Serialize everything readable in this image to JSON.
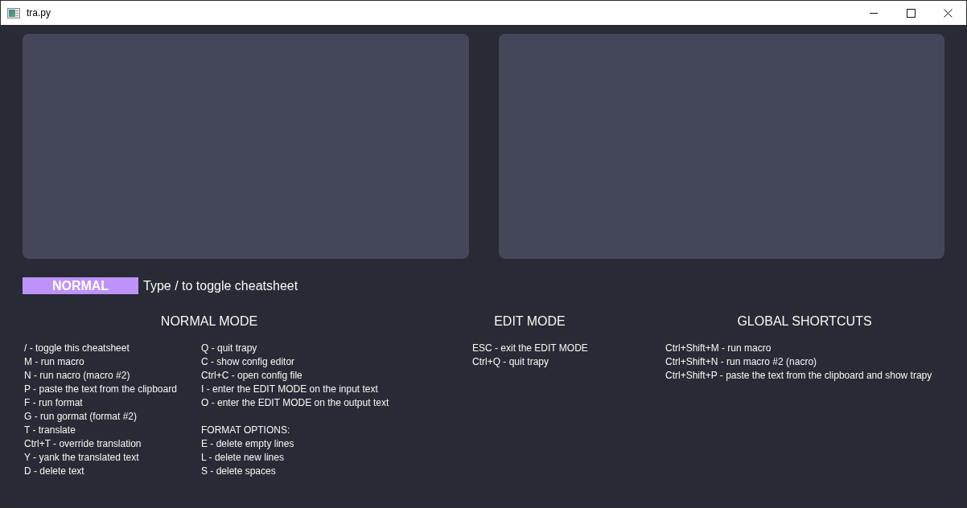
{
  "window": {
    "title": "tra.py"
  },
  "mode_bar": {
    "mode": "NORMAL",
    "hint": "Type / to toggle cheatsheet"
  },
  "cheatsheet": [
    {
      "title": "NORMAL MODE",
      "columns": [
        {
          "groups": [
            {
              "lines": [
                "/ - toggle this cheatsheet",
                "M - run macro",
                "N - run nacro (macro #2)",
                "P - paste the text from the clipboard",
                "F - run format",
                "G - run gormat (format #2)",
                "T - translate",
                "Ctrl+T - override translation",
                "Y - yank the translated text",
                "D - delete text"
              ]
            }
          ]
        },
        {
          "groups": [
            {
              "lines": [
                "Q - quit trapy",
                "C - show config editor",
                "Ctrl+C - open config file",
                "I - enter the EDIT MODE on the input text",
                "O - enter the EDIT MODE on the output text"
              ]
            },
            {
              "heading": "FORMAT OPTIONS:",
              "lines": [
                "E - delete empty lines",
                "L - delete new lines",
                "S - delete spaces"
              ]
            }
          ]
        }
      ]
    },
    {
      "title": "EDIT MODE",
      "columns": [
        {
          "groups": [
            {
              "lines": [
                "ESC - exit the EDIT MODE",
                "Ctrl+Q - quit trapy"
              ]
            }
          ]
        }
      ]
    },
    {
      "title": "GLOBAL SHORTCUTS",
      "columns": [
        {
          "groups": [
            {
              "lines": [
                "Ctrl+Shift+M - run macro",
                "Ctrl+Shift+N - run macro #2 (nacro)",
                "Ctrl+Shift+P - paste the text from the clipboard and show trapy"
              ]
            }
          ]
        }
      ]
    }
  ]
}
